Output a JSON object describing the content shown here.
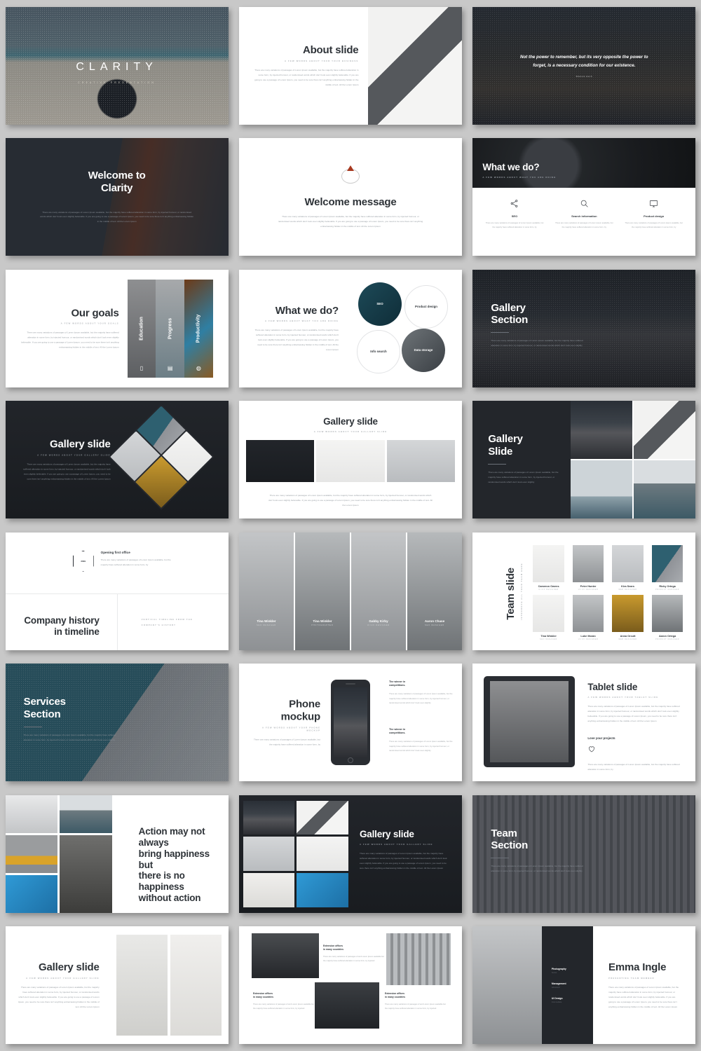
{
  "theme": {
    "background": "#c8c8c8",
    "dark": "#23262b",
    "light": "#ffffff",
    "accent": "#a8391f",
    "text_dark": "#2e3338",
    "text_muted": "#9aa0a6"
  },
  "lorem": {
    "short": "There are many variations of passages of Lorem Ipsum available, but the majority have suffered alteration in some form, by injected humour, or randomised words which don't look even slightly believable. If you are going to use a passage of Lorem Ipsum, you need to be sure there isn't anything embarrassing hidden in the middle of text. All the Lorem Ipsum",
    "tiny": "There are many variations of passages of Lorem Ipsum available, but the majority have suffered alteration in some form, by",
    "mid": "There are many variations of passages of Lorem Ipsum available, but the majority have suffered alteration in some form, by injected humour, or randomised words which don't look even slightly",
    "xs": "There are many variations of passages of and Lorem Ipsum available but the majority have suffered alteration in some form, by injected"
  },
  "slides": [
    {
      "id": "cover",
      "title": "CLARITY",
      "subtitle": "CREATIVE PRESENTATION"
    },
    {
      "id": "about",
      "title": "About slide",
      "subtitle": "A FEW WORDS ABOUT YOUR YOUR BUSINESS"
    },
    {
      "id": "quote-1",
      "quote": "Not the power to remember, but its very opposite the power to forget, is a necessary condition for our existence.",
      "author": "Sholem Asch"
    },
    {
      "id": "welcome",
      "title": "Welcome to\nClarity",
      "title_l1": "Welcome to",
      "title_l2": "Clarity"
    },
    {
      "id": "welcome-message",
      "title": "Welcome message",
      "logo": "drop-logo-icon"
    },
    {
      "id": "what-we-do-cols",
      "title": "What we do?",
      "subtitle": "A FEW WORDS ABOUT WHAT YOU ARE DOING",
      "columns": [
        {
          "icon": "share-icon",
          "name": "SEO"
        },
        {
          "icon": "search-icon",
          "name": "Search information"
        },
        {
          "icon": "monitor-icon",
          "name": "Product design"
        }
      ]
    },
    {
      "id": "our-goals",
      "title": "Our goals",
      "subtitle": "A FEW WORDS ABOUT YOUR GOALS",
      "panels": [
        {
          "label": "Education",
          "icon": "book-icon"
        },
        {
          "label": "Progress",
          "icon": "chart-icon"
        },
        {
          "label": "Productivity",
          "icon": "gear-icon"
        }
      ]
    },
    {
      "id": "what-we-do-circles",
      "title": "What we do?",
      "subtitle": "A FEW WORDS ABOUT WHAT YOU ARE DOING",
      "bubbles": [
        "SEO",
        "Product design",
        "Info search",
        "Data storage"
      ]
    },
    {
      "id": "gallery-section",
      "title_l1": "Gallery",
      "title_l2": "Section"
    },
    {
      "id": "gallery-diamond",
      "title": "Gallery slide",
      "subtitle": "A FEW WORDS ABOUT YOUR GALLERY SLIDE"
    },
    {
      "id": "gallery-three",
      "title": "Gallery slide",
      "subtitle": "A FEW WORDS ABOUT YOUR GALLERY SLIDE"
    },
    {
      "id": "gallery-grid",
      "title_l1": "Gallery",
      "title_l2": "Slide"
    },
    {
      "id": "timeline",
      "title_l1": "Company history",
      "title_l2": "in timeline",
      "side_note_l1": "VERTICAL TIMELINE FROM THE",
      "side_note_l2": "COMPANY'S HISTORY",
      "event_title": "Opening first office",
      "event_year": "2009"
    },
    {
      "id": "team-portraits",
      "members": [
        {
          "name": "Tina Winkler",
          "role": "SEO MANAGER"
        },
        {
          "name": "Tina Winkler",
          "role": "PHOTOGRAPHER"
        },
        {
          "name": "Gabby Kirby",
          "role": "UI/UX DESIGNER"
        },
        {
          "name": "Aaron Chase",
          "role": "SEO MANAGER"
        }
      ]
    },
    {
      "id": "team-grid",
      "title": "Team slide",
      "subtitle": "INTRODUCE ALL YOUR TEAM HERE",
      "members": [
        {
          "name": "Cameron Owens",
          "role": "UI/UX DESIGNER"
        },
        {
          "name": "Peter Hunter",
          "role": "UI/UX DESIGNER"
        },
        {
          "name": "Kira Sears",
          "role": "WEB DESIGNER"
        },
        {
          "name": "Ricky Ortega",
          "role": "PRODUCT MANAGER"
        },
        {
          "name": "Tina Winkler",
          "role": "SEO MANAGER"
        },
        {
          "name": "Luke Moran",
          "role": "UI/UX DESIGNER"
        },
        {
          "name": "Anna Orcutt",
          "role": "WEB DESIGNER"
        },
        {
          "name": "Aaron Ortega",
          "role": "PRODUCT MANAGER"
        }
      ]
    },
    {
      "id": "services-section",
      "title_l1": "Services",
      "title_l2": "Section"
    },
    {
      "id": "phone-mockup",
      "title": "Phone mockup",
      "subtitle": "A FEW WORDS ABOUT YOUR PHONE MOCKUP",
      "blocks": [
        {
          "heading_l1": "The winner in",
          "heading_l2": "competitions."
        },
        {
          "heading_l1": "The winner in",
          "heading_l2": "competitions."
        }
      ]
    },
    {
      "id": "tablet-slide",
      "title": "Tablet slide",
      "subtitle": "A FEW WORDS ABOUT YOUR TABLET SLIDE",
      "footer_title": "Love your projects",
      "footer_icon": "heart-icon"
    },
    {
      "id": "quote-2",
      "quote_l1": "Action may not always",
      "quote_l2": "bring happiness but",
      "quote_l3": "there is no happiness",
      "quote_l4": "without action"
    },
    {
      "id": "gallery-mosaic",
      "title": "Gallery slide",
      "subtitle": "A FEW WORDS ABOUT YOUR GALLERY SLIDE"
    },
    {
      "id": "team-section",
      "title_l1": "Team",
      "title_l2": "Section"
    },
    {
      "id": "gallery-two",
      "title": "Gallery slide",
      "subtitle": "A FEW WORDS ABOUT YOUR GALLERY SLIDE"
    },
    {
      "id": "extension-offices",
      "blocks": [
        {
          "heading_l1": "Extension offices",
          "heading_l2": "in many countries"
        },
        {
          "heading_l1": "Extension offices",
          "heading_l2": "in many countries"
        },
        {
          "heading_l1": "Extension offices",
          "heading_l2": "in many countries"
        }
      ]
    },
    {
      "id": "person-profile",
      "name": "Emma Ingle",
      "subtitle": "PRESENTING TEAM MEMBER",
      "skills": [
        {
          "name": "Photography",
          "level": "Senior"
        },
        {
          "name": "Management",
          "level": "Advanced"
        },
        {
          "name": "UI Design",
          "level": "Intermediate"
        }
      ]
    }
  ]
}
